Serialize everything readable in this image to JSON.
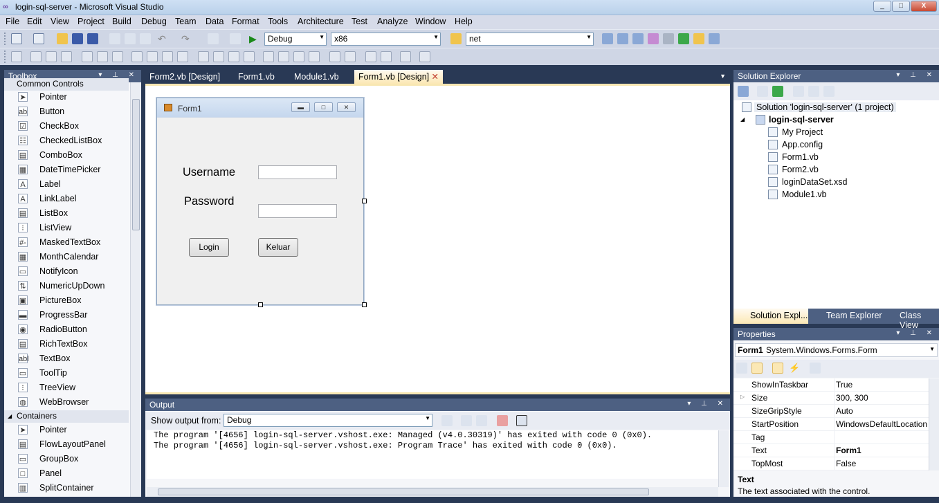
{
  "window": {
    "title": "login-sql-server - Microsoft Visual Studio",
    "min": "_",
    "max": "□",
    "close": "X"
  },
  "menu": [
    "File",
    "Edit",
    "View",
    "Project",
    "Build",
    "Debug",
    "Team",
    "Data",
    "Format",
    "Tools",
    "Architecture",
    "Test",
    "Analyze",
    "Window",
    "Help"
  ],
  "toolbar": {
    "config": "Debug",
    "platform": "x86",
    "find": "net"
  },
  "toolbox": {
    "title": "Toolbox",
    "groups": [
      {
        "name": "Common Controls",
        "items": [
          "Pointer",
          "Button",
          "CheckBox",
          "CheckedListBox",
          "ComboBox",
          "DateTimePicker",
          "Label",
          "LinkLabel",
          "ListBox",
          "ListView",
          "MaskedTextBox",
          "MonthCalendar",
          "NotifyIcon",
          "NumericUpDown",
          "PictureBox",
          "ProgressBar",
          "RadioButton",
          "RichTextBox",
          "TextBox",
          "ToolTip",
          "TreeView",
          "WebBrowser"
        ]
      },
      {
        "name": "Containers",
        "items": [
          "Pointer",
          "FlowLayoutPanel",
          "GroupBox",
          "Panel",
          "SplitContainer"
        ]
      }
    ]
  },
  "doc_tabs": [
    "Form2.vb [Design]",
    "Form1.vb",
    "Module1.vb",
    "Form1.vb [Design]"
  ],
  "form": {
    "title": "Form1",
    "username_label": "Username",
    "password_label": "Password",
    "login_button": "Login",
    "keluar_button": "Keluar"
  },
  "output": {
    "title": "Output",
    "show_from_label": "Show output from:",
    "source": "Debug",
    "lines": [
      "The program '[4656] login-sql-server.vshost.exe: Managed (v4.0.30319)' has exited with code 0 (0x0).",
      "The program '[4656] login-sql-server.vshost.exe: Program Trace' has exited with code 0 (0x0)."
    ]
  },
  "solution_explorer": {
    "title": "Solution Explorer",
    "solution": "Solution 'login-sql-server' (1 project)",
    "project": "login-sql-server",
    "files": [
      "My Project",
      "App.config",
      "Form1.vb",
      "Form2.vb",
      "loginDataSet.xsd",
      "Module1.vb"
    ],
    "tabs": [
      "Solution Expl...",
      "Team Explorer",
      "Class View"
    ]
  },
  "properties": {
    "title": "Properties",
    "object": "Form1",
    "object_type": "System.Windows.Forms.Form",
    "rows": [
      {
        "name": "ShowInTaskbar",
        "value": "True"
      },
      {
        "name": "Size",
        "value": "300, 300"
      },
      {
        "name": "SizeGripStyle",
        "value": "Auto"
      },
      {
        "name": "StartPosition",
        "value": "WindowsDefaultLocation"
      },
      {
        "name": "Tag",
        "value": ""
      },
      {
        "name": "Text",
        "value": "Form1"
      },
      {
        "name": "TopMost",
        "value": "False"
      }
    ],
    "desc_title": "Text",
    "desc_text": "The text associated with the control."
  }
}
